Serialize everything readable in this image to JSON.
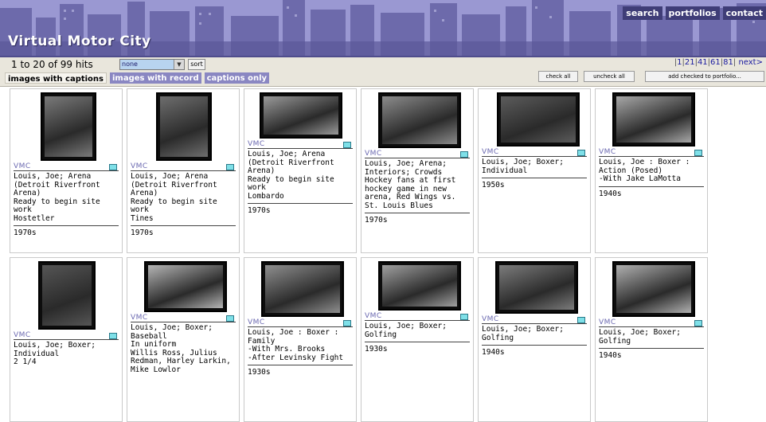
{
  "header": {
    "site_title": "Virtual Motor City",
    "nav": [
      "search",
      "portfolios",
      "contact"
    ]
  },
  "toolbar": {
    "hits_text": "1 to 20  of  99 hits",
    "sort_value": "none",
    "sort_button": "sort",
    "pager": [
      "1",
      "21",
      "41",
      "61",
      "81"
    ],
    "next_label": "next>",
    "tabs": [
      "images with captions",
      "images with record",
      "captions only"
    ],
    "active_tab": "images with captions",
    "check_all": "check all",
    "uncheck_all": "uncheck all",
    "add_checked": "add checked to portfolio..."
  },
  "colors": {
    "banner": "#8e8cc8",
    "nav_bg": "#3f3d77",
    "tab_inactive": "#8a87c2",
    "vmc_text": "#6a68b0",
    "flag": "#7fe0e8",
    "pager_link": "#1a1aa0"
  },
  "results": [
    {
      "source": "VMC",
      "caption": "Louis, Joe; Arena\n(Detroit Riverfront\nArena)\nReady to begin site\nwork\nHostetler",
      "decade": "1970s",
      "thumb": "arena-construction-aerial"
    },
    {
      "source": "VMC",
      "caption": "Louis, Joe; Arena\n(Detroit Riverfront\nArena)\nReady to begin site\nwork\nTines",
      "decade": "1970s",
      "thumb": "arena-site-signs"
    },
    {
      "source": "VMC",
      "caption": "Louis, Joe; Arena\n(Detroit Riverfront\nArena)\nReady to begin site\nwork\nLombardo",
      "decade": "1970s",
      "thumb": "riverfront-skyline"
    },
    {
      "source": "VMC",
      "caption": "Louis, Joe; Arena;\nInteriors; Crowds\nHockey fans at first\nhockey game in new\narena, Red Wings vs.\nSt. Louis Blues",
      "decade": "1970s",
      "thumb": "hockey-crowd"
    },
    {
      "source": "VMC",
      "caption": "Louis, Joe; Boxer;\nIndividual",
      "decade": "1950s",
      "thumb": "portrait-seated"
    },
    {
      "source": "VMC",
      "caption": "Louis, Joe : Boxer :\nAction (Posed)\n-With Jake LaMotta",
      "decade": "1940s",
      "thumb": "boxers-sparring"
    },
    {
      "source": "VMC",
      "caption": "Louis, Joe; Boxer;\nIndividual\n2 1/4",
      "decade": "",
      "thumb": "portrait-closeup"
    },
    {
      "source": "VMC",
      "caption": "Louis, Joe; Boxer;\nBaseball\nIn uniform\nWillis Ross, Julius\nRedman, Harley Larkin,\nMike Lowlor",
      "decade": "",
      "thumb": "baseball-team"
    },
    {
      "source": "VMC",
      "caption": "Louis, Joe : Boxer :\nFamily\n-With Mrs. Brooks\n-After Levinsky Fight",
      "decade": "1930s",
      "thumb": "window-family"
    },
    {
      "source": "VMC",
      "caption": "Louis, Joe; Boxer;\nGolfing",
      "decade": "1930s",
      "thumb": "golf-swing-crowd"
    },
    {
      "source": "VMC",
      "caption": "Louis, Joe; Boxer;\nGolfing",
      "decade": "1940s",
      "thumb": "golf-swing-field"
    },
    {
      "source": "VMC",
      "caption": "Louis, Joe; Boxer;\nGolfing",
      "decade": "1940s",
      "thumb": "golf-group"
    }
  ]
}
